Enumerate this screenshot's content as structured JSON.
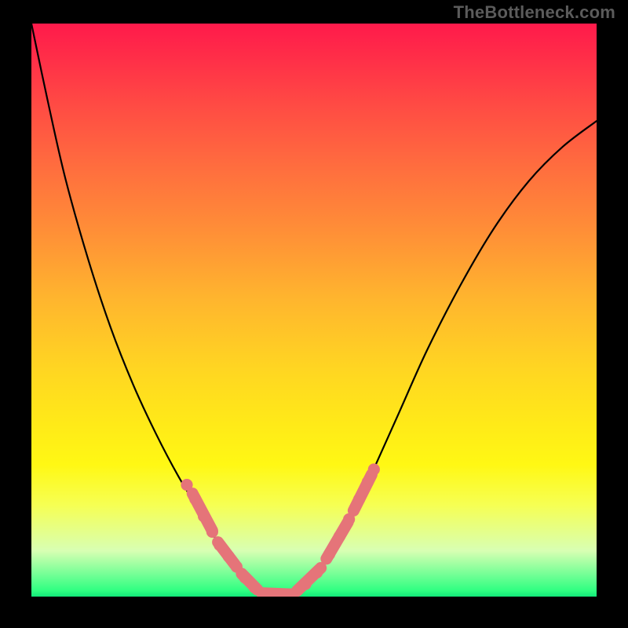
{
  "watermark": "TheBottleneck.com",
  "chart_data": {
    "type": "line",
    "title": "",
    "xlabel": "",
    "ylabel": "",
    "xlim": [
      0,
      1
    ],
    "ylim": [
      0,
      1
    ],
    "series": [
      {
        "name": "curve",
        "x": [
          0.0,
          0.03,
          0.06,
          0.1,
          0.14,
          0.18,
          0.22,
          0.26,
          0.3,
          0.33,
          0.36,
          0.395,
          0.43,
          0.47,
          0.52,
          0.56,
          0.6,
          0.65,
          0.7,
          0.76,
          0.82,
          0.88,
          0.94,
          1.0
        ],
        "y": [
          1.0,
          0.86,
          0.73,
          0.59,
          0.47,
          0.37,
          0.285,
          0.21,
          0.145,
          0.095,
          0.055,
          0.018,
          0.0,
          0.01,
          0.058,
          0.125,
          0.21,
          0.32,
          0.43,
          0.545,
          0.645,
          0.725,
          0.785,
          0.83
        ]
      }
    ],
    "beads": {
      "name": "beads",
      "points": [
        {
          "x": 0.275,
          "y": 0.195
        },
        {
          "x": 0.29,
          "y": 0.17
        },
        {
          "x": 0.305,
          "y": 0.14
        },
        {
          "x": 0.32,
          "y": 0.113
        },
        {
          "x": 0.333,
          "y": 0.09
        },
        {
          "x": 0.349,
          "y": 0.07
        },
        {
          "x": 0.363,
          "y": 0.052
        },
        {
          "x": 0.378,
          "y": 0.033
        },
        {
          "x": 0.395,
          "y": 0.016
        },
        {
          "x": 0.415,
          "y": 0.004
        },
        {
          "x": 0.435,
          "y": 0.0
        },
        {
          "x": 0.46,
          "y": 0.004
        },
        {
          "x": 0.485,
          "y": 0.022
        },
        {
          "x": 0.505,
          "y": 0.042
        },
        {
          "x": 0.527,
          "y": 0.074
        },
        {
          "x": 0.545,
          "y": 0.105
        },
        {
          "x": 0.562,
          "y": 0.135
        },
        {
          "x": 0.58,
          "y": 0.17
        },
        {
          "x": 0.595,
          "y": 0.2
        },
        {
          "x": 0.606,
          "y": 0.222
        }
      ]
    },
    "pills": [
      {
        "x1": 0.285,
        "y1": 0.18,
        "x2": 0.32,
        "y2": 0.115
      },
      {
        "x1": 0.33,
        "y1": 0.095,
        "x2": 0.36,
        "y2": 0.056
      },
      {
        "x1": 0.372,
        "y1": 0.04,
        "x2": 0.4,
        "y2": 0.012
      },
      {
        "x1": 0.408,
        "y1": 0.006,
        "x2": 0.46,
        "y2": 0.004
      },
      {
        "x1": 0.47,
        "y1": 0.01,
        "x2": 0.512,
        "y2": 0.05
      },
      {
        "x1": 0.522,
        "y1": 0.066,
        "x2": 0.56,
        "y2": 0.13
      },
      {
        "x1": 0.57,
        "y1": 0.15,
        "x2": 0.602,
        "y2": 0.213
      }
    ]
  }
}
